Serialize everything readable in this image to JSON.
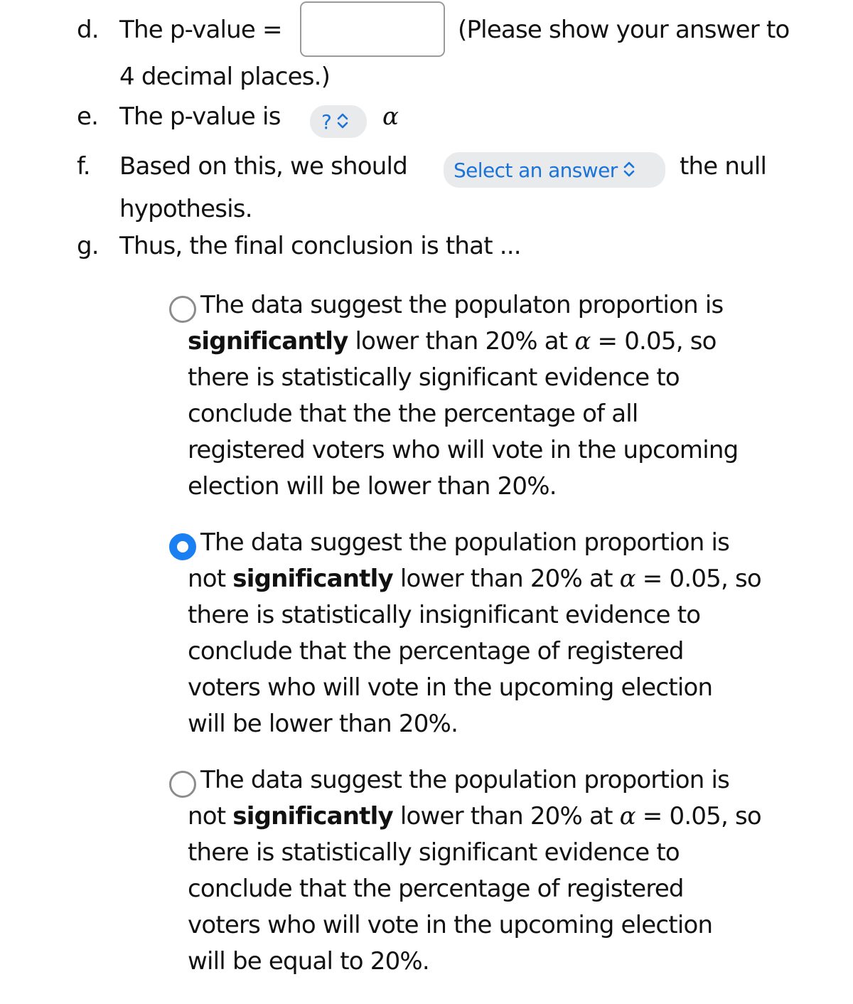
{
  "questions": {
    "d": {
      "marker": "d.",
      "label": "The p-value =",
      "input_value": "",
      "hint_line1": "(Please show your answer to",
      "hint_line2": "4 decimal places.)"
    },
    "e": {
      "marker": "e.",
      "label": "The p-value is",
      "select_value": "?",
      "alpha": "α"
    },
    "f": {
      "marker": "f.",
      "label": "Based on this, we should",
      "select_value": "Select an answer",
      "after": "the null",
      "line2": "hypothesis."
    },
    "g": {
      "marker": "g.",
      "label": "Thus, the final conclusion is that ..."
    }
  },
  "options": [
    {
      "selected": false,
      "lines": [
        {
          "pre": "The data suggest the populaton proportion is",
          "bold": "",
          "post": ""
        },
        {
          "pre": "",
          "bold": "significantly",
          "post": " lower than 20% at ",
          "alpha": "α",
          "post2": " = 0.05, so"
        },
        {
          "pre": "there is statistically significant evidence to",
          "bold": "",
          "post": ""
        },
        {
          "pre": "conclude that the the percentage of all",
          "bold": "",
          "post": ""
        },
        {
          "pre": "registered voters who will vote in the upcoming",
          "bold": "",
          "post": ""
        },
        {
          "pre": "election will be lower than 20%.",
          "bold": "",
          "post": ""
        }
      ]
    },
    {
      "selected": true,
      "lines": [
        {
          "pre": "The data suggest the population proportion is",
          "bold": "",
          "post": ""
        },
        {
          "pre": "not ",
          "bold": "significantly",
          "post": " lower than 20% at ",
          "alpha": "α",
          "post2": " = 0.05, so"
        },
        {
          "pre": "there is statistically insignificant evidence to",
          "bold": "",
          "post": ""
        },
        {
          "pre": "conclude that the percentage of registered",
          "bold": "",
          "post": ""
        },
        {
          "pre": "voters who will vote in the upcoming election",
          "bold": "",
          "post": ""
        },
        {
          "pre": "will be lower than 20%.",
          "bold": "",
          "post": ""
        }
      ]
    },
    {
      "selected": false,
      "lines": [
        {
          "pre": "The data suggest the population proportion is",
          "bold": "",
          "post": ""
        },
        {
          "pre": "not ",
          "bold": "significantly",
          "post": " lower than 20% at ",
          "alpha": "α",
          "post2": " = 0.05, so"
        },
        {
          "pre": "there is statistically significant evidence to",
          "bold": "",
          "post": ""
        },
        {
          "pre": "conclude that the percentage of registered",
          "bold": "",
          "post": ""
        },
        {
          "pre": "voters who will vote in the upcoming election",
          "bold": "",
          "post": ""
        },
        {
          "pre": "will be equal to 20%.",
          "bold": "",
          "post": ""
        }
      ]
    }
  ],
  "colors": {
    "accent": "#1a7ff0",
    "select_text": "#1a73d8",
    "select_bg": "#e9eaec"
  }
}
